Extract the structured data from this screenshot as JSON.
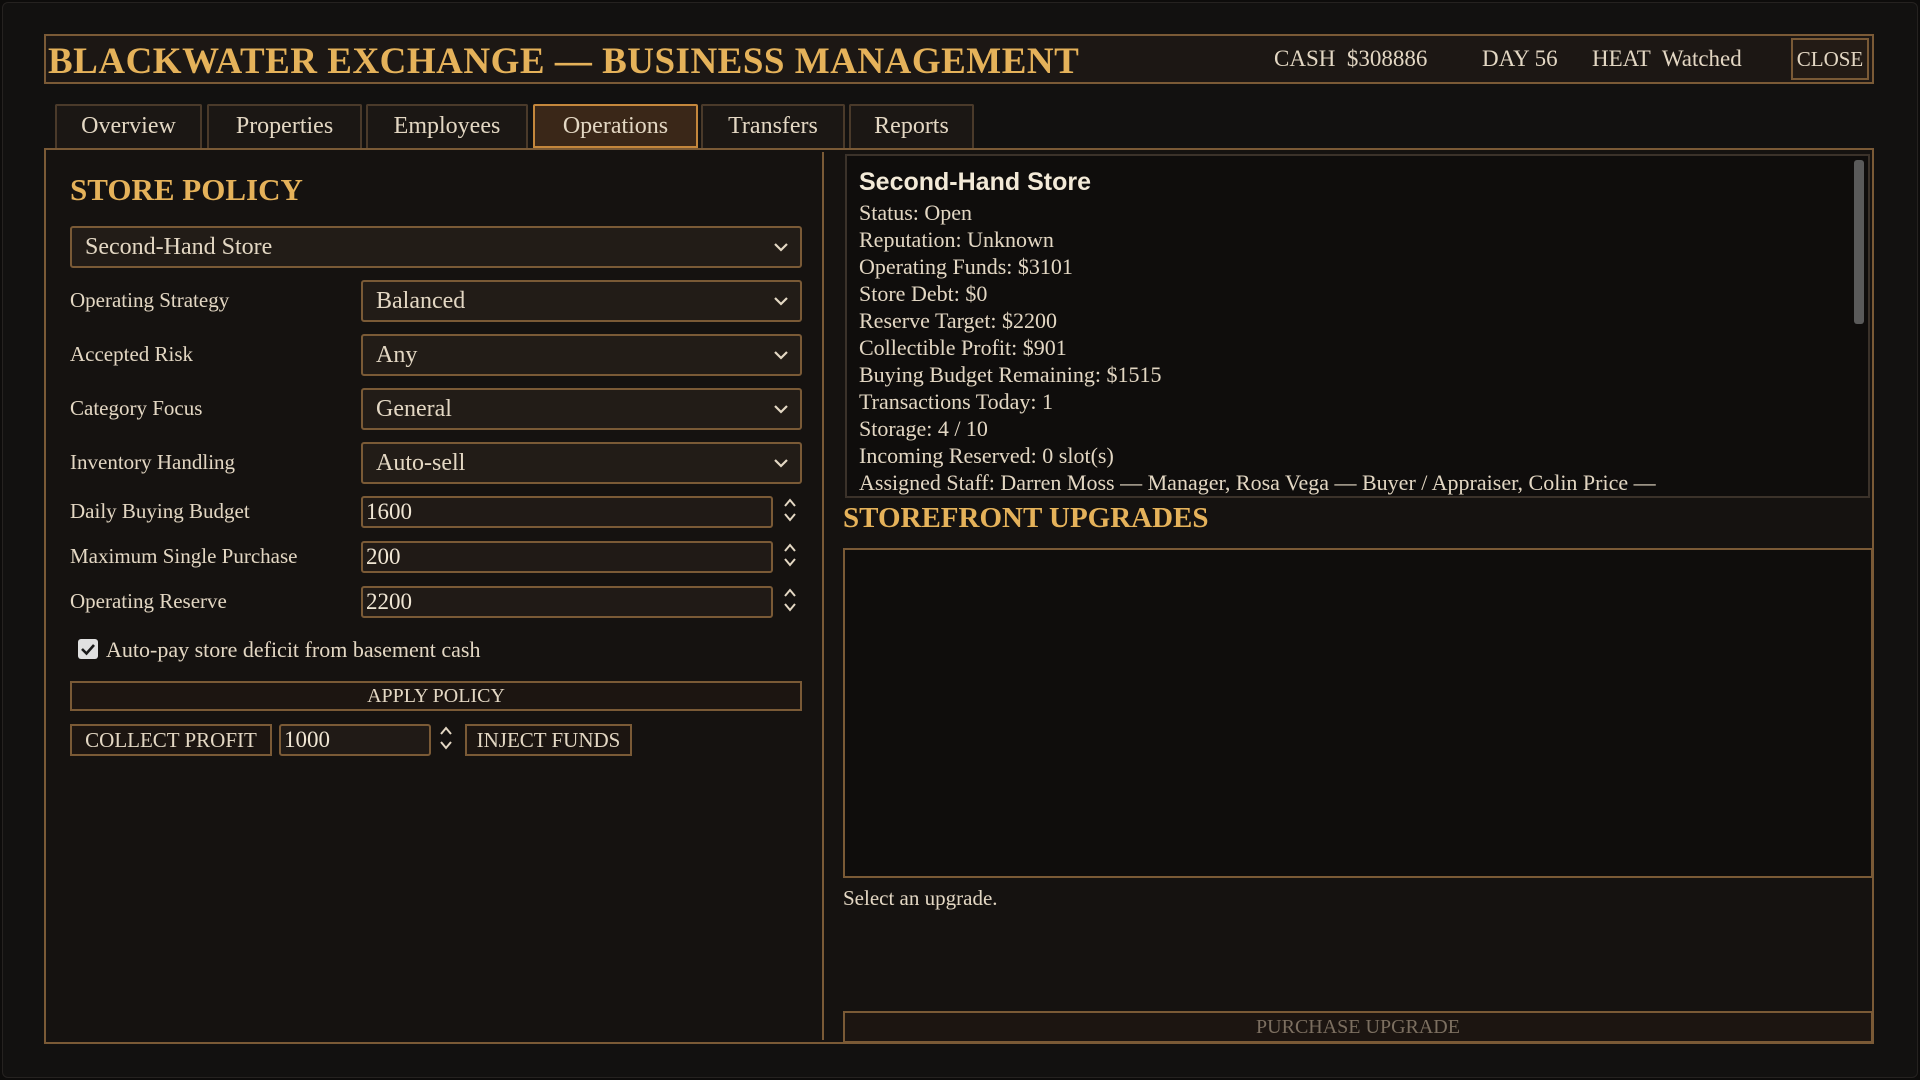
{
  "header": {
    "title": "BLACKWATER EXCHANGE — BUSINESS MANAGEMENT",
    "cash_label": "CASH",
    "cash_value": "$308886",
    "day_label": "DAY",
    "day_value": "56",
    "heat_label": "HEAT",
    "heat_value": "Watched",
    "close_label": "CLOSE"
  },
  "tabs": [
    {
      "label": "Overview",
      "active": false
    },
    {
      "label": "Properties",
      "active": false
    },
    {
      "label": "Employees",
      "active": false
    },
    {
      "label": "Operations",
      "active": true
    },
    {
      "label": "Transfers",
      "active": false
    },
    {
      "label": "Reports",
      "active": false
    }
  ],
  "store_policy": {
    "heading": "STORE POLICY",
    "store_select": "Second-Hand Store",
    "fields": [
      {
        "label": "Operating Strategy",
        "value": "Balanced"
      },
      {
        "label": "Accepted Risk",
        "value": "Any"
      },
      {
        "label": "Category Focus",
        "value": "General"
      },
      {
        "label": "Inventory Handling",
        "value": "Auto-sell"
      }
    ],
    "numeric_fields": [
      {
        "label": "Daily Buying Budget",
        "value": "1600"
      },
      {
        "label": "Maximum Single Purchase",
        "value": "200"
      },
      {
        "label": "Operating Reserve",
        "value": "2200"
      }
    ],
    "autopay_checked": true,
    "autopay_label": "Auto-pay store deficit from basement cash",
    "apply_label": "APPLY POLICY",
    "collect_label": "COLLECT PROFIT",
    "amount_value": "1000",
    "inject_label": "INJECT FUNDS"
  },
  "store_info": {
    "name": "Second-Hand Store",
    "lines": [
      "Status: Open",
      "Reputation: Unknown",
      "Operating Funds: $3101",
      "Store Debt: $0",
      "Reserve Target: $2200",
      "Collectible Profit: $901",
      "Buying Budget Remaining: $1515",
      "Transactions Today: 1",
      "Storage: 4 / 10",
      "Incoming Reserved: 0 slot(s)",
      "Assigned Staff: Darren Moss — Manager, Rosa Vega — Buyer / Appraiser, Colin Price —"
    ]
  },
  "upgrades": {
    "heading": "STOREFRONT UPGRADES",
    "hint": "Select an upgrade.",
    "purchase_label": "PURCHASE UPGRADE"
  },
  "colors": {
    "accent_gold": "#e5b25a",
    "border_bronze": "#7a5a36",
    "active_tab": "#c4873c",
    "background": "#0d0c0b"
  }
}
